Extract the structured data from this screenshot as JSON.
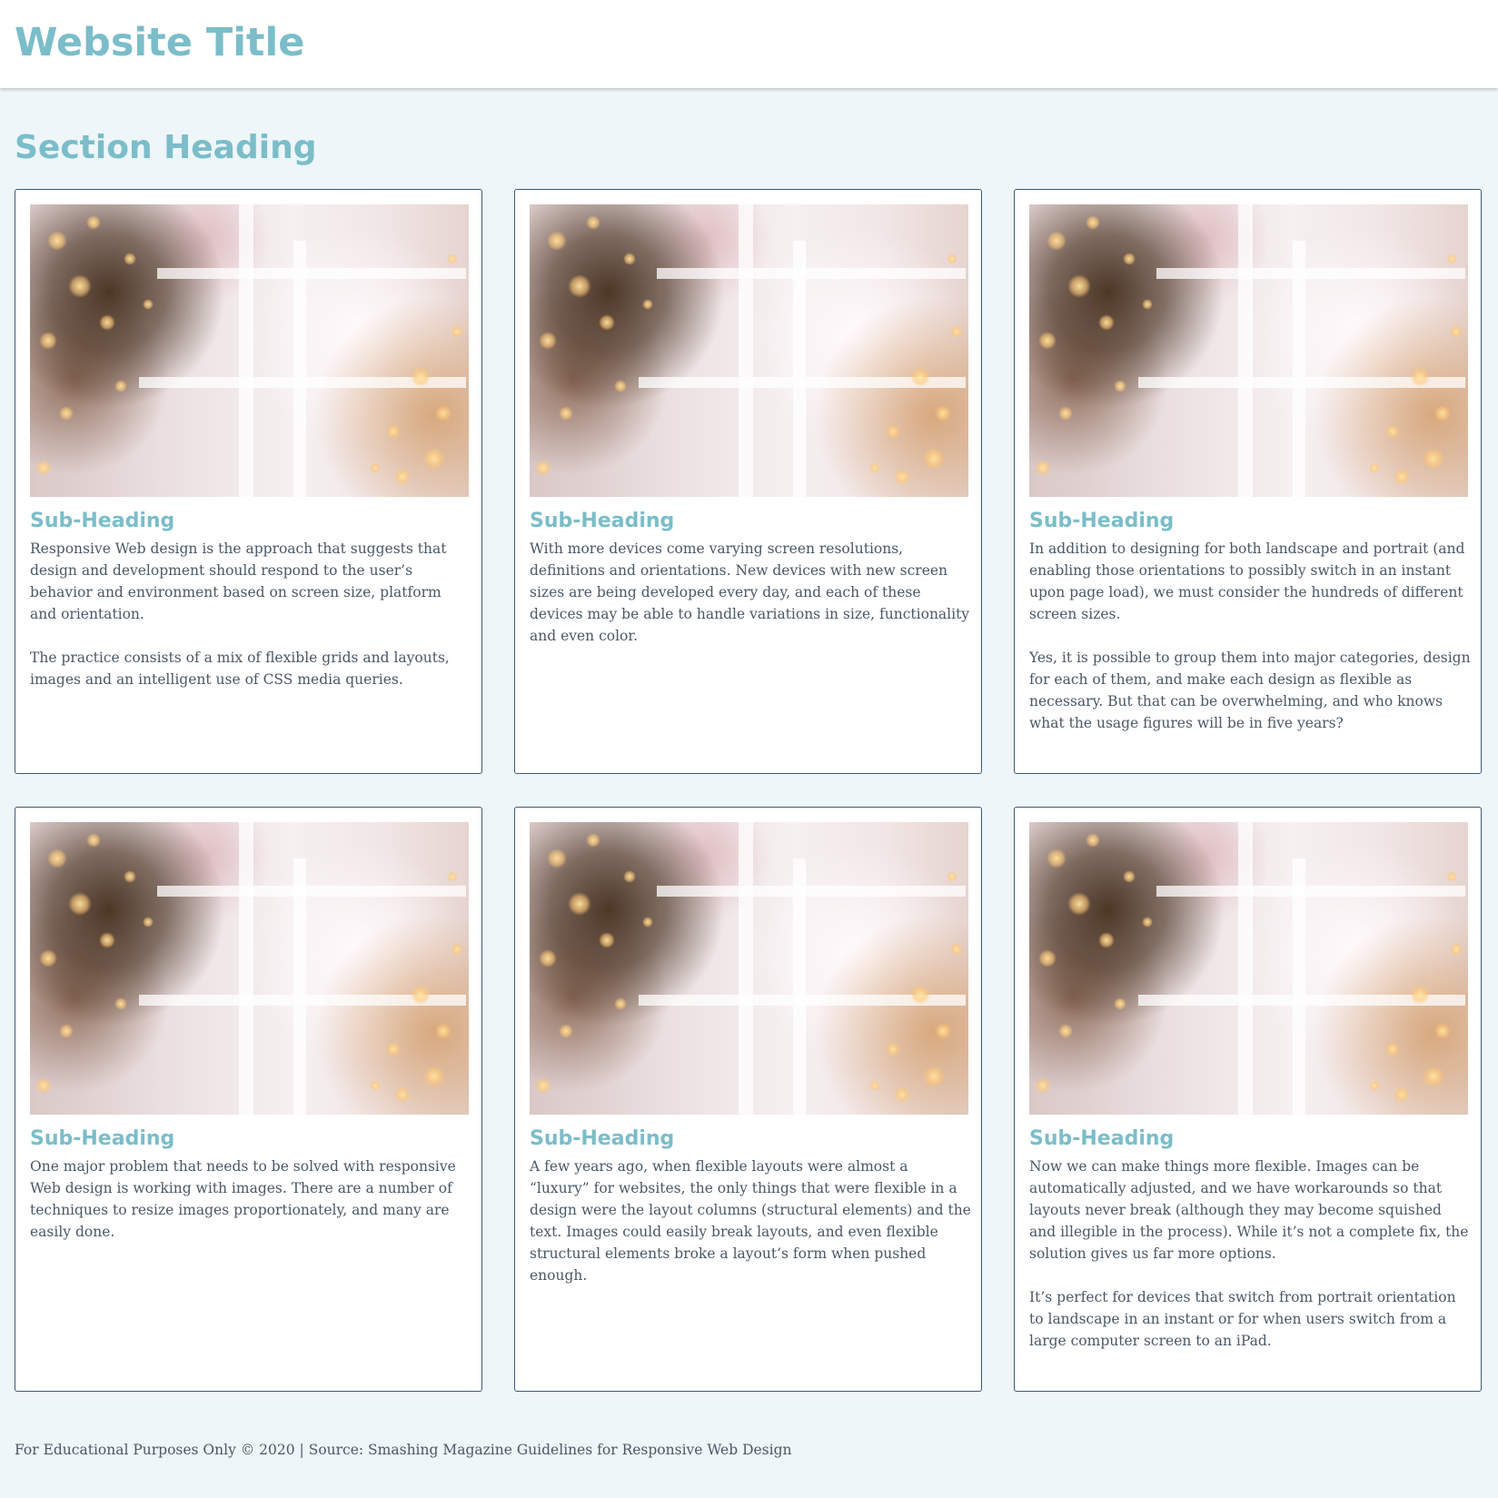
{
  "header": {
    "site_title": "Website Title"
  },
  "main": {
    "section_heading": "Section Heading",
    "cards": [
      {
        "subheading": "Sub-Heading",
        "paragraphs": [
          "Responsive Web design is the approach that suggests that design and development should respond to the user’s behavior and environment based on screen size, platform and orientation.",
          "The practice consists of a mix of flexible grids and layouts, images and an intelligent use of CSS media queries."
        ]
      },
      {
        "subheading": "Sub-Heading",
        "paragraphs": [
          "With more devices come varying screen resolutions, definitions and orientations. New devices with new screen sizes are being developed every day, and each of these devices may be able to handle variations in size, functionality and even color."
        ]
      },
      {
        "subheading": "Sub-Heading",
        "paragraphs": [
          "In addition to designing for both landscape and portrait (and enabling those orientations to possibly switch in an instant upon page load), we must consider the hundreds of different screen sizes.",
          "Yes, it is possible to group them into major categories, design for each of them, and make each design as flexible as necessary. But that can be overwhelming, and who knows what the usage figures will be in five years?"
        ]
      },
      {
        "subheading": "Sub-Heading",
        "paragraphs": [
          "One major problem that needs to be solved with responsive Web design is working with images. There are a number of techniques to resize images proportionately, and many are easily done."
        ]
      },
      {
        "subheading": "Sub-Heading",
        "paragraphs": [
          "A few years ago, when flexible layouts were almost a “luxury” for websites, the only things that were flexible in a design were the layout columns (structural elements) and the text. Images could easily break layouts, and even flexible structural elements broke a layout’s form when pushed enough."
        ]
      },
      {
        "subheading": "Sub-Heading",
        "paragraphs": [
          "Now we can make things more flexible. Images can be automatically adjusted, and we have workarounds so that layouts never break (although they may become squished and illegible in the process). While it’s not a complete fix, the solution gives us far more options.",
          "It’s perfect for devices that switch from portrait orientation to landscape in an instant or for when users switch from a large computer screen to an iPad."
        ]
      }
    ]
  },
  "footer": {
    "text": "For Educational Purposes Only © 2020 | Source: Smashing Magazine Guidelines for Responsive Web Design"
  },
  "colors": {
    "accent": "#7bbdc9",
    "page_background": "#eef6f9",
    "card_border": "#3d5a78",
    "body_text": "#4a5866"
  }
}
